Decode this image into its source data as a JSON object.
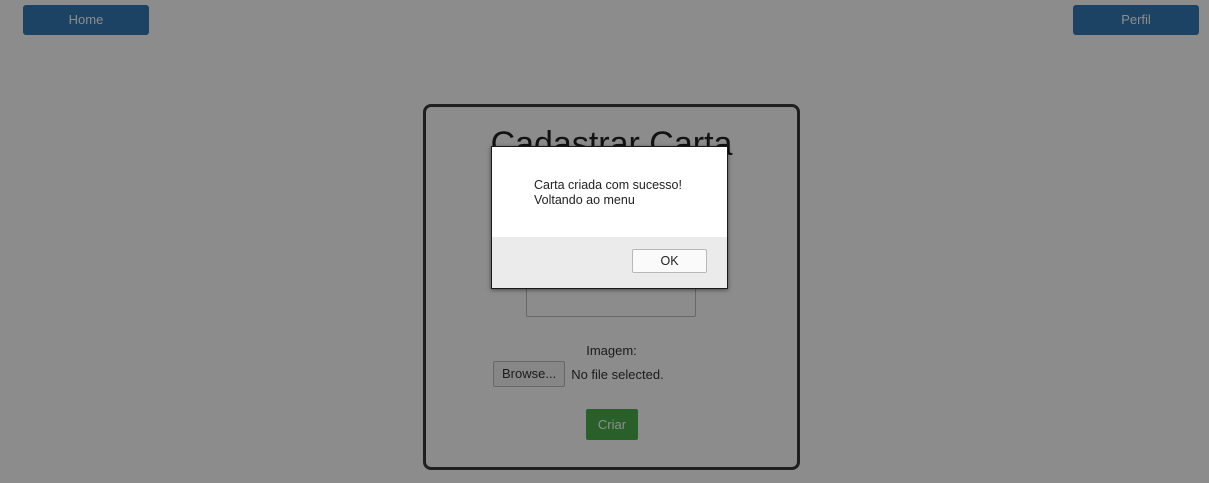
{
  "nav": {
    "home_label": "Home",
    "perfil_label": "Perfil"
  },
  "form": {
    "title": "Cadastrar Carta",
    "image_label": "Imagem:",
    "browse_label": "Browse...",
    "file_status": "No file selected.",
    "submit_label": "Criar"
  },
  "dialog": {
    "message_line1": "Carta criada com sucesso!",
    "message_line2": "Voltando ao menu",
    "ok_label": "OK"
  },
  "colors": {
    "nav_button": "#337ab7",
    "submit_button": "#4cae4c",
    "overlay": "rgba(0,0,0,0.45)"
  }
}
